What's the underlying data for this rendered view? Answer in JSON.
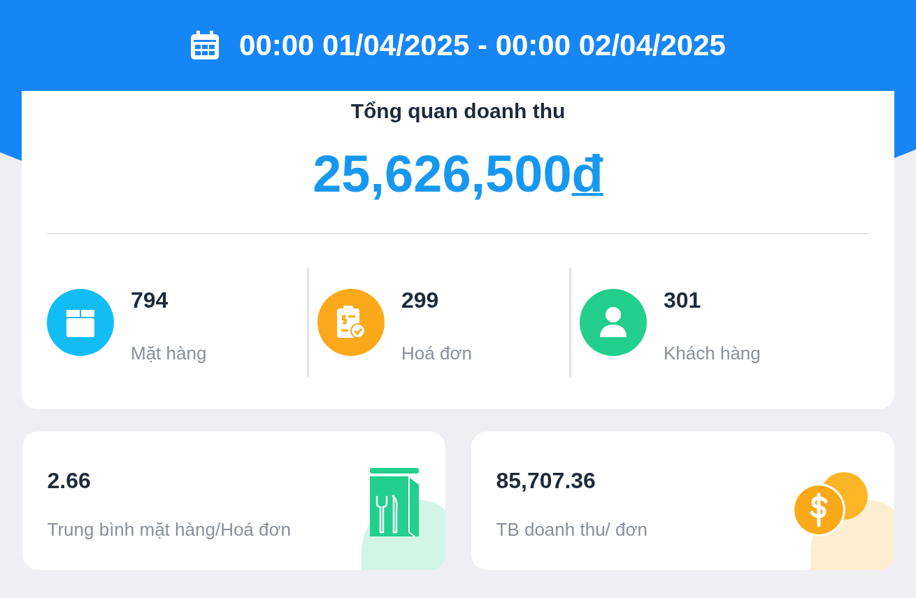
{
  "header": {
    "date_range": "00:00 01/04/2025 - 00:00 02/04/2025"
  },
  "overview": {
    "title": "Tổng quan doanh thu",
    "amount": "25,626,500",
    "currency": "đ",
    "stats": [
      {
        "kind": "box",
        "color": "#12bdf5",
        "value": "794",
        "label": "Mặt hàng"
      },
      {
        "kind": "invoice",
        "color": "#fba91a",
        "value": "299",
        "label": "Hoá đơn"
      },
      {
        "kind": "person",
        "color": "#22cf8c",
        "value": "301",
        "label": "Khách hàng"
      }
    ]
  },
  "averages": [
    {
      "kind": "bag",
      "color": "#22cf8c",
      "value": "2.66",
      "label": "Trung bình mặt hàng/Hoá đơn"
    },
    {
      "kind": "coins",
      "color": "#fba91a",
      "value": "85,707.36",
      "label": "TB doanh thu/ đơn"
    }
  ]
}
